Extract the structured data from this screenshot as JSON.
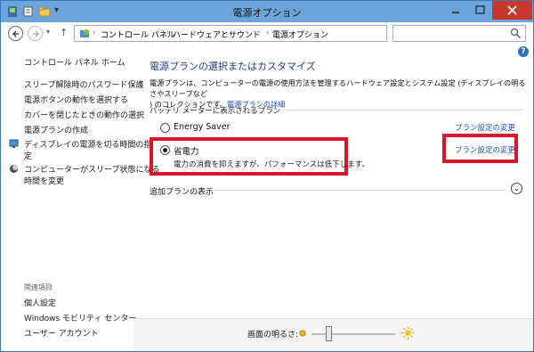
{
  "window": {
    "title": "電源オプション"
  },
  "address": {
    "breadcrumbs": [
      "コントロール パネル",
      "ハードウェアとサウンド",
      "電源オプション"
    ]
  },
  "sidebar": {
    "home": "コントロール パネル ホーム",
    "links": [
      "スリープ解除時のパスワード保護",
      "電源ボタンの動作を選択する",
      "カバーを閉じたときの動作の選択",
      "電源プランの作成",
      "ディスプレイの電源を切る時間の指定",
      "コンピューターがスリープ状態になる時間を変更"
    ],
    "display_line1": "ディスプレイの電源を切る時間の指",
    "display_line2": "定",
    "sleep_line1": "コンピューターがスリープ状態になる",
    "sleep_line2": "時間を変更",
    "related_heading": "関連項目",
    "related": [
      "個人設定",
      "Windows モビリティ センター",
      "ユーザー アカウント"
    ]
  },
  "main": {
    "heading": "電源プランの選択またはカスタマイズ",
    "desc_line1": "電源プランは、コンピューターの電源の使用方法を管理するハードウェア設定とシステム設定 (ディスプレイの明るさやスリープなど",
    "desc_line2": ") のコレクションです。",
    "desc_link": "電源プランの詳細",
    "section": "バッテリ メーターに表示されるプラン",
    "plans": [
      {
        "name": "Energy Saver",
        "selected": false,
        "link": "プラン設定の変更"
      },
      {
        "name": "省電力",
        "selected": true,
        "desc": "電力の消費を抑えますが、パフォーマンスは低下します。",
        "link": "プラン設定の変更"
      }
    ],
    "more_plans": "追加プランの表示"
  },
  "brightness": {
    "label": "画面の明るさ:",
    "level": 0.2
  },
  "colors": {
    "accent": "#1e3e8c",
    "link": "#1a56c0",
    "highlight": "#d9162a",
    "titlebar": "#6aa6dc",
    "close": "#c7382b"
  }
}
